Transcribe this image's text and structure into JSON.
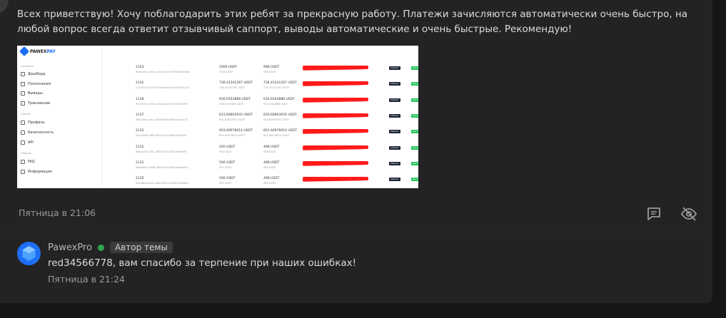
{
  "post": {
    "text": "Всех приветствую! Хочу поблагодарить этих ребят за прекрасную работу. Платежи зачисляются автоматически очень быстро, на любой вопрос всегда ответит отзывчивый саппорт, выводы автоматические и очень быстрые. Рекомендую!",
    "timestamp": "Пятница в 21:06",
    "actions": {
      "reply_icon": "comment-icon",
      "hide_icon": "eye-off-icon"
    }
  },
  "attachment": {
    "logo_a": "PAWEX",
    "logo_b": "PAY",
    "sidebar": {
      "section_main": "Основное",
      "dashboard": "Дашборд",
      "deposits": "Пополнения",
      "withdrawals": "Выводы",
      "transactions": "Транзакции",
      "section_other": "Прочее",
      "profile": "Профиль",
      "security": "Безопасность",
      "api": "API",
      "section_help": "Помощь",
      "faq": "FAQ",
      "info": "Информация"
    },
    "rows": [
      {
        "id": "1143",
        "hash": "9ba61a6c-a0da-4515-a029-9c99881485db",
        "amount": "1000 USDT",
        "amount_sub": "1000 USDT",
        "net": "998 USDT",
        "net_sub": "998 USDT",
        "cabinet": "Кабинет",
        "status": "Выполнено"
      },
      {
        "id": "1142",
        "hash": "cc316c33-8c53-403a-8b0e-b4920e081118",
        "amount": "736.41241267 USDT",
        "amount_sub": "736.41241267 USDT",
        "net": "734.41241267 USDT",
        "net_sub": "734.41241267 USDT",
        "cabinet": "Кабинет",
        "status": "Выполнено"
      },
      {
        "id": "1138",
        "hash": "99c7534e-1f36-44ea-b802-f33e5de6190f",
        "amount": "636.9163888 USDT",
        "amount_sub": "636.9163888 USDT",
        "net": "634.9163888 USDT",
        "net_sub": "634.9163888 USDT",
        "cabinet": "Кабинет",
        "status": "Выполнено"
      },
      {
        "id": "1137",
        "hash": "56cc348c-e4c1-4e0f-9680-960bda4c3c74",
        "amount": "631.60803933 USDT",
        "amount_sub": "631.60803933 USDT",
        "net": "629.60803933 USDT",
        "net_sub": "629.60803933 USDT",
        "cabinet": "Кабинет",
        "status": "Выполнено"
      },
      {
        "id": "1133",
        "hash": "04cd0e8b-59f0-4694-bc7b-a6d3ecf2860",
        "amount": "603.60976614 USDT",
        "amount_sub": "603.60976614 USDT",
        "net": "601.60976614 USDT",
        "net_sub": "601.60976614 USDT",
        "cabinet": "Кабинет",
        "status": "Выполнено"
      },
      {
        "id": "1132",
        "hash": "98b1ec05-5f92-489f-a575-d0323e8fe5f5",
        "amount": "500 USDT",
        "amount_sub": "500 USDT",
        "net": "498 USDT",
        "net_sub": "498 USDT",
        "cabinet": "Кабинет",
        "status": "Выполнено"
      },
      {
        "id": "1131",
        "hash": "659ebbc4-63a6-46f6-9cd2-605b8ed6d542",
        "amount": "500 USDT",
        "amount_sub": "500 USDT",
        "net": "498 USDT",
        "net_sub": "498 USDT",
        "cabinet": "Кабинет",
        "status": "Выполнено"
      },
      {
        "id": "1130",
        "hash": "d4f0a8d0-8a0c-4b63-9a03-b3f6d75b6dba",
        "amount": "500 USDT",
        "amount_sub": "500 USDT",
        "net": "498 USDT",
        "net_sub": "498 USDT",
        "cabinet": "Кабинет",
        "status": "Выполнено"
      }
    ]
  },
  "reply": {
    "author": "PawexPro",
    "badge": "Автор темы",
    "mention": "red34566778",
    "text": ", вам спасибо за терпение при наших ошибках!",
    "timestamp": "Пятница в 21:24"
  },
  "colors": {
    "accent": "#1e6ef5",
    "online": "#2ea44f",
    "redact": "#ff1a1a",
    "status_ok": "#23c55e"
  }
}
